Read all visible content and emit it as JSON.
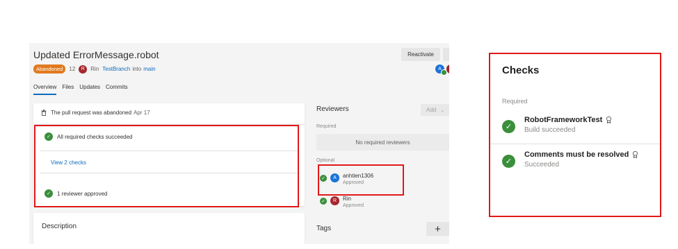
{
  "pr": {
    "title": "Updated ErrorMessage.robot",
    "status_badge": "Abandoned",
    "id": "12",
    "author_initial": "R",
    "author": "Rin",
    "source_branch": "TestBranch",
    "into": "into",
    "target_branch": "main",
    "reactivate_label": "Reactivate",
    "header_avatar_initial": "A"
  },
  "tabs": [
    "Overview",
    "Files",
    "Updates",
    "Commits"
  ],
  "overview": {
    "abandoned_text": "The pull request was abandoned",
    "abandoned_date": "Apr 17",
    "checks_summary": "All required checks succeeded",
    "view_checks": "View 2 checks",
    "reviewer_summary": "1 reviewer approved",
    "description_title": "Description"
  },
  "reviewers": {
    "title": "Reviewers",
    "add_label": "Add",
    "required_heading": "Required",
    "no_required": "No required reviewers",
    "optional_heading": "Optional",
    "list": [
      {
        "initial": "A",
        "name": "anhtien1306",
        "status": "Approved",
        "color": "#1a73d9"
      },
      {
        "initial": "R",
        "name": "Rin",
        "status": "Approved",
        "color": "#a4262c"
      }
    ]
  },
  "tags": {
    "title": "Tags",
    "add_symbol": "+"
  },
  "checks_panel": {
    "title": "Checks",
    "required_heading": "Required",
    "items": [
      {
        "name": "RobotFrameworkTest",
        "status": "Build succeeded"
      },
      {
        "name": "Comments must be resolved",
        "status": "Succeeded"
      }
    ]
  },
  "colors": {
    "accent": "#0f6cbd",
    "success": "#3b8f3b",
    "highlight": "#e01818",
    "abandoned": "#e07a1f"
  }
}
